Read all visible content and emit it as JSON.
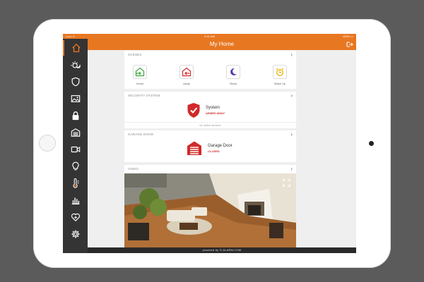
{
  "status_bar": {
    "left": "•••••• ᯤ",
    "time": "9:41 AM",
    "right": "100% ▭"
  },
  "header": {
    "title": "My Home"
  },
  "sidebar": {
    "items": [
      {
        "icon": "home-icon",
        "active": true
      },
      {
        "icon": "scene-icon",
        "active": false
      },
      {
        "icon": "shield-icon",
        "active": false
      },
      {
        "icon": "image-icon",
        "active": false
      },
      {
        "icon": "lock-icon",
        "active": false
      },
      {
        "icon": "garage-icon",
        "active": false
      },
      {
        "icon": "video-camera-icon",
        "active": false
      },
      {
        "icon": "lightbulb-icon",
        "active": false
      },
      {
        "icon": "thermostat-icon",
        "active": false
      },
      {
        "icon": "bar-chart-icon",
        "active": false
      },
      {
        "icon": "health-icon",
        "active": false
      },
      {
        "icon": "gear-icon",
        "active": false
      }
    ]
  },
  "scenes": {
    "title": "SCENES",
    "items": [
      {
        "label": "Home",
        "icon": "home-arrive-icon",
        "color": "#3aa53a"
      },
      {
        "label": "Away",
        "icon": "home-leave-icon",
        "color": "#d12a2a"
      },
      {
        "label": "Sleep",
        "icon": "moon-icon",
        "color": "#5a3bb0"
      },
      {
        "label": "Wake Up",
        "icon": "alarm-clock-icon",
        "color": "#e8b400"
      }
    ]
  },
  "security": {
    "title": "SECURITY SYSTEM",
    "name": "System",
    "status": "ARMED AWAY",
    "footer": "No active sensors"
  },
  "garage": {
    "title": "GARAGE DOOR",
    "name": "Garage Door",
    "status": "CLOSED"
  },
  "video": {
    "title": "VIDEO"
  },
  "footer": {
    "brand": "powered by ⊙ ALARM.COM"
  },
  "colors": {
    "accent": "#e87722",
    "sidebar": "#343434",
    "alert": "#d12a2a"
  }
}
